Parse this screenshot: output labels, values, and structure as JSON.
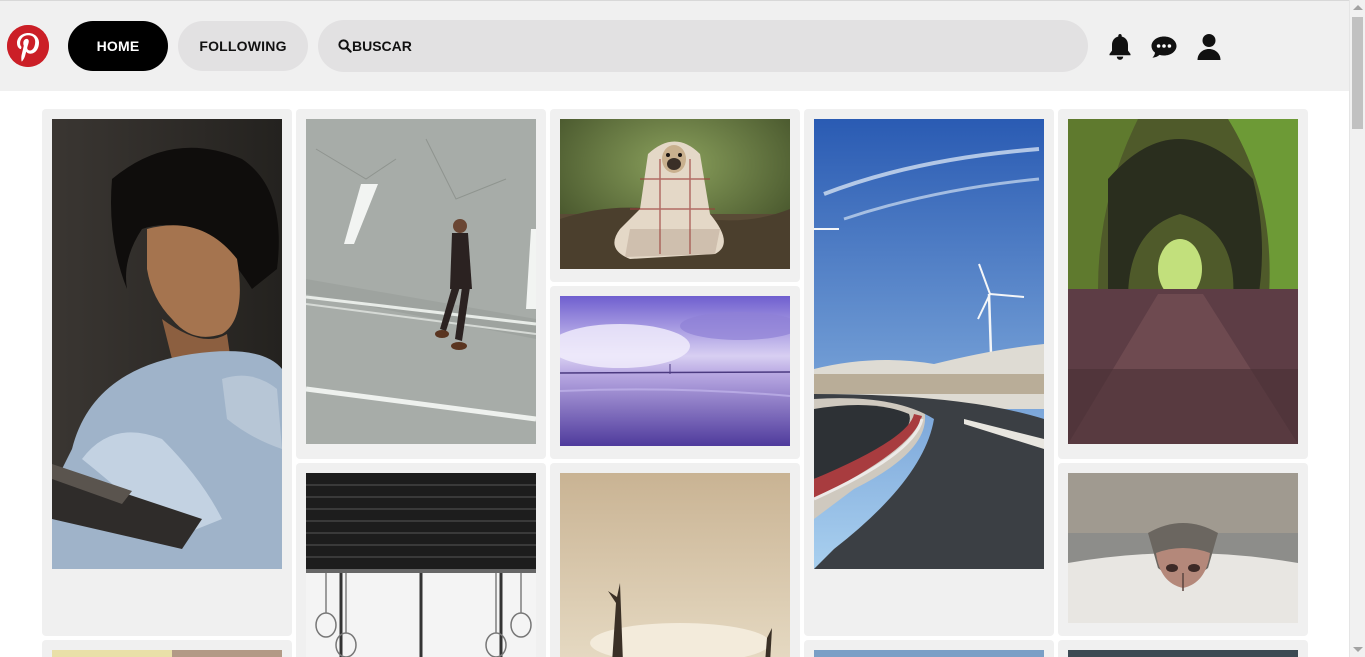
{
  "header": {
    "logo_icon": "pinterest-logo-icon",
    "home_label": "HOME",
    "following_label": "FOLLOWING",
    "search_icon": "search-icon",
    "search_text": "BUSCAR",
    "icons": [
      "bell-icon",
      "chat-icon",
      "user-icon"
    ]
  },
  "colors": {
    "brand": "#cb1f27",
    "home_bg": "#000000",
    "pill_bg": "#e2e1e2",
    "header_bg": "#f0f0f0",
    "card_bg": "#f0f0f0"
  },
  "pins": [
    {
      "name": "pin-woman-reading",
      "subject": "woman reading book"
    },
    {
      "name": "pin-man-walking-street",
      "subject": "man walking on street"
    },
    {
      "name": "pin-dog-blanket",
      "subject": "dog wrapped in plaid blanket"
    },
    {
      "name": "pin-purple-sea-bridge",
      "subject": "purple sea with bridge"
    },
    {
      "name": "pin-wind-turbines-road",
      "subject": "curved road with wind turbines"
    },
    {
      "name": "pin-tree-tunnel",
      "subject": "green tree tunnel path"
    },
    {
      "name": "pin-cat-nose",
      "subject": "cat nose close-up"
    },
    {
      "name": "pin-window-lamps",
      "subject": "window with hanging lamps"
    },
    {
      "name": "pin-foggy-trees",
      "subject": "foggy sepia dead trees"
    }
  ]
}
